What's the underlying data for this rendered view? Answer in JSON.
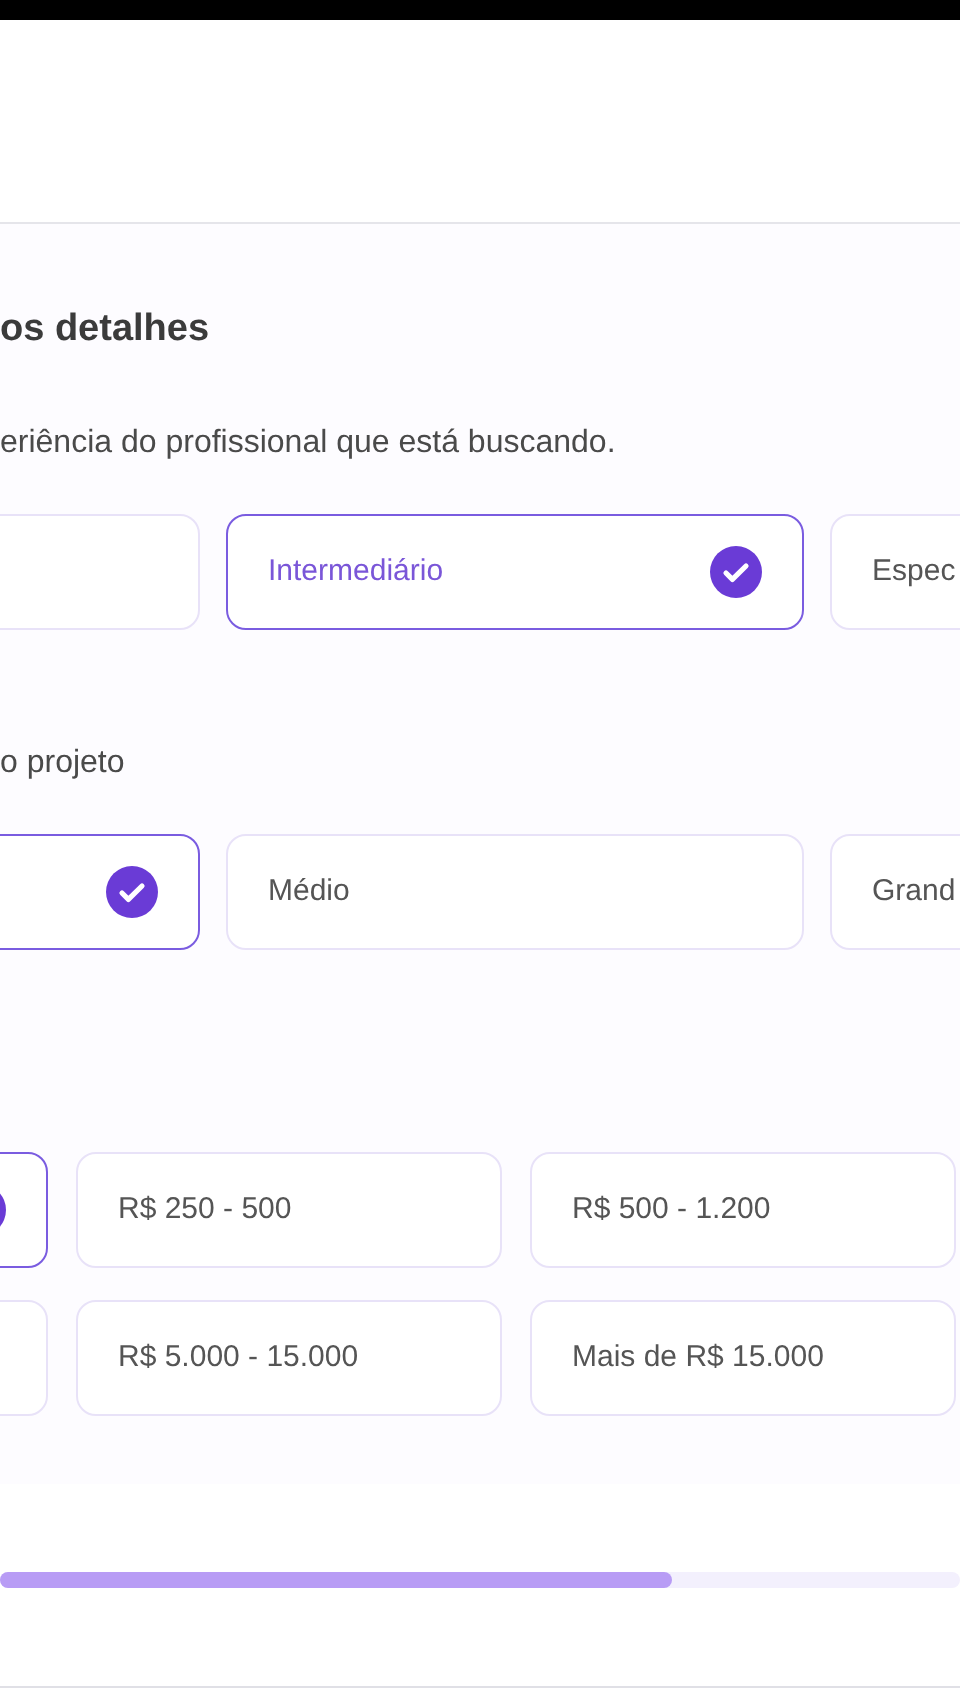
{
  "section": {
    "title": "os detalhes"
  },
  "experience": {
    "prompt": "eriência do profissional que está buscando.",
    "options": [
      {
        "selected": false
      },
      {
        "label": "Intermediário",
        "selected": true
      },
      {
        "label": "Espec",
        "selected": false
      }
    ]
  },
  "size": {
    "prompt": "o projeto",
    "options": [
      {
        "selected": true
      },
      {
        "label": "Médio",
        "selected": false
      },
      {
        "label": "Grand",
        "selected": false
      }
    ]
  },
  "budget": {
    "options": [
      {
        "selected": true
      },
      {
        "label": "R$ 250 - 500",
        "selected": false
      },
      {
        "label": "R$ 500 - 1.200",
        "selected": false
      },
      {
        "selected": false
      },
      {
        "label": "R$ 5.000 - 15.000",
        "selected": false
      },
      {
        "label": "Mais de R$ 15.000",
        "selected": false
      }
    ]
  },
  "progress": {
    "level": 0.7
  }
}
